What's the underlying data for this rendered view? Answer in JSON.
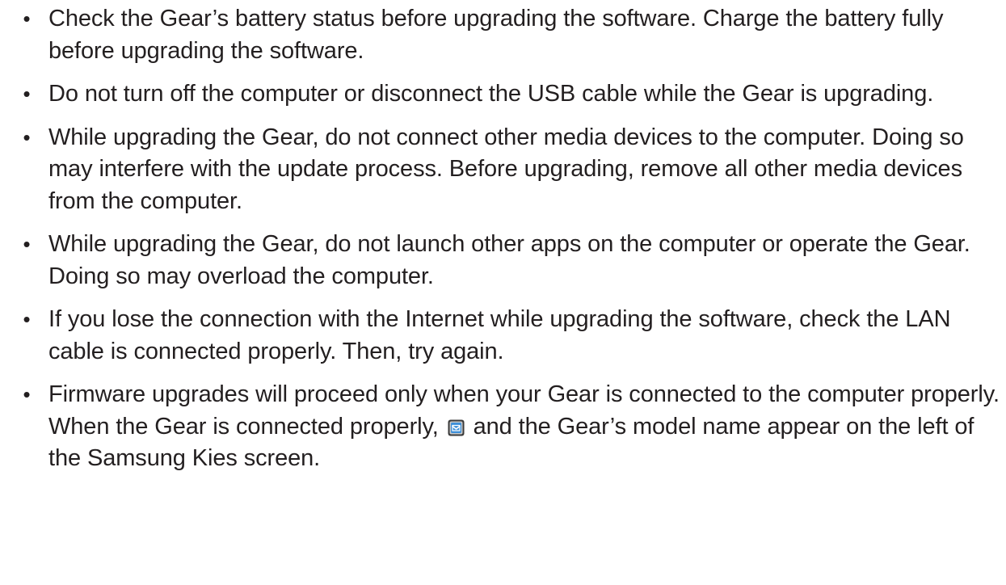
{
  "notes": [
    {
      "text": "Check the Gear’s battery status before upgrading the software. Charge the battery fully before upgrading the software."
    },
    {
      "text": "Do not turn off the computer or disconnect the USB cable while the Gear is upgrading."
    },
    {
      "text": "While upgrading the Gear, do not connect other media devices to the computer. Doing so may interfere with the update process. Before upgrading, remove all other media devices from the computer."
    },
    {
      "text": "While upgrading the Gear, do not launch other apps on the computer or operate the Gear. Doing so may overload the computer."
    },
    {
      "text": "If you lose the connection with the Internet while upgrading the software, check the LAN cable is connected properly. Then, try again."
    },
    {
      "text_before": "Firmware upgrades will proceed only when your Gear is connected to the computer properly. When the Gear is connected properly,",
      "icon": "gear-device-icon",
      "text_after": "and the Gear’s model name appear on the left of the Samsung Kies screen."
    }
  ],
  "bullet_symbol": "•"
}
